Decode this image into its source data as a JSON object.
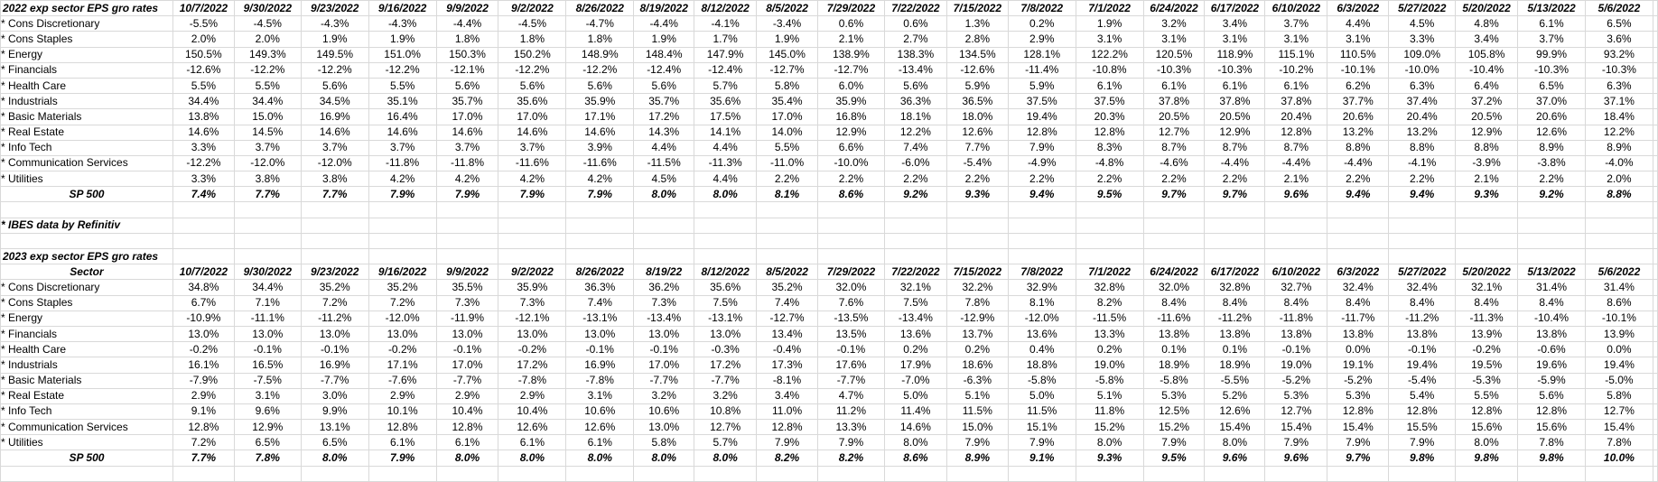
{
  "table_2022": {
    "title": "2022 exp sector EPS gro rates",
    "dates": [
      "10/7/2022",
      "9/30/2022",
      "9/23/2022",
      "9/16/2022",
      "9/9/2022",
      "9/2/2022",
      "8/26/2022",
      "8/19/2022",
      "8/12/2022",
      "8/5/2022",
      "7/29/2022",
      "7/22/2022",
      "7/15/2022",
      "7/8/2022",
      "7/1/2022",
      "6/24/2022",
      "6/17/2022",
      "6/10/2022",
      "6/3/2022",
      "5/27/2022",
      "5/20/2022",
      "5/13/2022",
      "5/6/2022"
    ],
    "rows": [
      {
        "label": "* Cons Discretionary",
        "values": [
          "-5.5%",
          "-4.5%",
          "-4.3%",
          "-4.3%",
          "-4.4%",
          "-4.5%",
          "-4.7%",
          "-4.4%",
          "-4.1%",
          "-3.4%",
          "0.6%",
          "0.6%",
          "1.3%",
          "0.2%",
          "1.9%",
          "3.2%",
          "3.4%",
          "3.7%",
          "4.4%",
          "4.5%",
          "4.8%",
          "6.1%",
          "6.5%"
        ]
      },
      {
        "label": "* Cons Staples",
        "values": [
          "2.0%",
          "2.0%",
          "1.9%",
          "1.9%",
          "1.8%",
          "1.8%",
          "1.8%",
          "1.9%",
          "1.7%",
          "1.9%",
          "2.1%",
          "2.7%",
          "2.8%",
          "2.9%",
          "3.1%",
          "3.1%",
          "3.1%",
          "3.1%",
          "3.1%",
          "3.3%",
          "3.4%",
          "3.7%",
          "3.6%"
        ]
      },
      {
        "label": "* Energy",
        "values": [
          "150.5%",
          "149.3%",
          "149.5%",
          "151.0%",
          "150.3%",
          "150.2%",
          "148.9%",
          "148.4%",
          "147.9%",
          "145.0%",
          "138.9%",
          "138.3%",
          "134.5%",
          "128.1%",
          "122.2%",
          "120.5%",
          "118.9%",
          "115.1%",
          "110.5%",
          "109.0%",
          "105.8%",
          "99.9%",
          "93.2%"
        ]
      },
      {
        "label": "* Financials",
        "values": [
          "-12.6%",
          "-12.2%",
          "-12.2%",
          "-12.2%",
          "-12.1%",
          "-12.2%",
          "-12.2%",
          "-12.4%",
          "-12.4%",
          "-12.7%",
          "-12.7%",
          "-13.4%",
          "-12.6%",
          "-11.4%",
          "-10.8%",
          "-10.3%",
          "-10.3%",
          "-10.2%",
          "-10.1%",
          "-10.0%",
          "-10.4%",
          "-10.3%",
          "-10.3%"
        ]
      },
      {
        "label": "* Health Care",
        "values": [
          "5.5%",
          "5.5%",
          "5.6%",
          "5.5%",
          "5.6%",
          "5.6%",
          "5.6%",
          "5.6%",
          "5.7%",
          "5.8%",
          "6.0%",
          "5.6%",
          "5.9%",
          "5.9%",
          "6.1%",
          "6.1%",
          "6.1%",
          "6.1%",
          "6.2%",
          "6.3%",
          "6.4%",
          "6.5%",
          "6.3%"
        ]
      },
      {
        "label": "* Industrials",
        "values": [
          "34.4%",
          "34.4%",
          "34.5%",
          "35.1%",
          "35.7%",
          "35.6%",
          "35.9%",
          "35.7%",
          "35.6%",
          "35.4%",
          "35.9%",
          "36.3%",
          "36.5%",
          "37.5%",
          "37.5%",
          "37.8%",
          "37.8%",
          "37.8%",
          "37.7%",
          "37.4%",
          "37.2%",
          "37.0%",
          "37.1%"
        ]
      },
      {
        "label": "* Basic Materials",
        "values": [
          "13.8%",
          "15.0%",
          "16.9%",
          "16.4%",
          "17.0%",
          "17.0%",
          "17.1%",
          "17.2%",
          "17.5%",
          "17.0%",
          "16.8%",
          "18.1%",
          "18.0%",
          "19.4%",
          "20.3%",
          "20.5%",
          "20.5%",
          "20.4%",
          "20.6%",
          "20.4%",
          "20.5%",
          "20.6%",
          "18.4%"
        ]
      },
      {
        "label": "* Real Estate",
        "values": [
          "14.6%",
          "14.5%",
          "14.6%",
          "14.6%",
          "14.6%",
          "14.6%",
          "14.6%",
          "14.3%",
          "14.1%",
          "14.0%",
          "12.9%",
          "12.2%",
          "12.6%",
          "12.8%",
          "12.8%",
          "12.7%",
          "12.9%",
          "12.8%",
          "13.2%",
          "13.2%",
          "12.9%",
          "12.6%",
          "12.2%"
        ]
      },
      {
        "label": "* Info Tech",
        "values": [
          "3.3%",
          "3.7%",
          "3.7%",
          "3.7%",
          "3.7%",
          "3.7%",
          "3.9%",
          "4.4%",
          "4.4%",
          "5.5%",
          "6.6%",
          "7.4%",
          "7.7%",
          "7.9%",
          "8.3%",
          "8.7%",
          "8.7%",
          "8.7%",
          "8.8%",
          "8.8%",
          "8.8%",
          "8.9%",
          "8.9%"
        ]
      },
      {
        "label": "* Communication Services",
        "values": [
          "-12.2%",
          "-12.0%",
          "-12.0%",
          "-11.8%",
          "-11.8%",
          "-11.6%",
          "-11.6%",
          "-11.5%",
          "-11.3%",
          "-11.0%",
          "-10.0%",
          "-6.0%",
          "-5.4%",
          "-4.9%",
          "-4.8%",
          "-4.6%",
          "-4.4%",
          "-4.4%",
          "-4.4%",
          "-4.1%",
          "-3.9%",
          "-3.8%",
          "-4.0%"
        ]
      },
      {
        "label": "* Utilities",
        "values": [
          "3.3%",
          "3.8%",
          "3.8%",
          "4.2%",
          "4.2%",
          "4.2%",
          "4.2%",
          "4.5%",
          "4.4%",
          "2.2%",
          "2.2%",
          "2.2%",
          "2.2%",
          "2.2%",
          "2.2%",
          "2.2%",
          "2.2%",
          "2.1%",
          "2.2%",
          "2.2%",
          "2.1%",
          "2.2%",
          "2.0%"
        ]
      }
    ],
    "total": {
      "label": "SP 500",
      "values": [
        "7.4%",
        "7.7%",
        "7.7%",
        "7.9%",
        "7.9%",
        "7.9%",
        "7.9%",
        "8.0%",
        "8.0%",
        "8.1%",
        "8.6%",
        "9.2%",
        "9.3%",
        "9.4%",
        "9.5%",
        "9.7%",
        "9.7%",
        "9.6%",
        "9.4%",
        "9.4%",
        "9.3%",
        "9.2%",
        "8.8%"
      ]
    }
  },
  "note": "* IBES data by Refinitiv",
  "table_2023": {
    "title": "2023 exp sector EPS gro rates",
    "header_label": "Sector",
    "dates": [
      "10/7/2022",
      "9/30/2022",
      "9/23/2022",
      "9/16/2022",
      "9/9/2022",
      "9/2/2022",
      "8/26/2022",
      "8/19/22",
      "8/12/2022",
      "8/5/2022",
      "7/29/2022",
      "7/22/2022",
      "7/15/2022",
      "7/8/2022",
      "7/1/2022",
      "6/24/2022",
      "6/17/2022",
      "6/10/2022",
      "6/3/2022",
      "5/27/2022",
      "5/20/2022",
      "5/13/2022",
      "5/6/2022"
    ],
    "rows": [
      {
        "label": "* Cons Discretionary",
        "values": [
          "34.8%",
          "34.4%",
          "35.2%",
          "35.2%",
          "35.5%",
          "35.9%",
          "36.3%",
          "36.2%",
          "35.6%",
          "35.2%",
          "32.0%",
          "32.1%",
          "32.2%",
          "32.9%",
          "32.8%",
          "32.0%",
          "32.8%",
          "32.7%",
          "32.4%",
          "32.4%",
          "32.1%",
          "31.4%",
          "31.4%"
        ]
      },
      {
        "label": "* Cons Staples",
        "values": [
          "6.7%",
          "7.1%",
          "7.2%",
          "7.2%",
          "7.3%",
          "7.3%",
          "7.4%",
          "7.3%",
          "7.5%",
          "7.4%",
          "7.6%",
          "7.5%",
          "7.8%",
          "8.1%",
          "8.2%",
          "8.4%",
          "8.4%",
          "8.4%",
          "8.4%",
          "8.4%",
          "8.4%",
          "8.4%",
          "8.6%"
        ]
      },
      {
        "label": "* Energy",
        "values": [
          "-10.9%",
          "-11.1%",
          "-11.2%",
          "-12.0%",
          "-11.9%",
          "-12.1%",
          "-13.1%",
          "-13.4%",
          "-13.1%",
          "-12.7%",
          "-13.5%",
          "-13.4%",
          "-12.9%",
          "-12.0%",
          "-11.5%",
          "-11.6%",
          "-11.2%",
          "-11.8%",
          "-11.7%",
          "-11.2%",
          "-11.3%",
          "-10.4%",
          "-10.1%"
        ]
      },
      {
        "label": "* Financials",
        "values": [
          "13.0%",
          "13.0%",
          "13.0%",
          "13.0%",
          "13.0%",
          "13.0%",
          "13.0%",
          "13.0%",
          "13.0%",
          "13.4%",
          "13.5%",
          "13.6%",
          "13.7%",
          "13.6%",
          "13.3%",
          "13.8%",
          "13.8%",
          "13.8%",
          "13.8%",
          "13.8%",
          "13.9%",
          "13.8%",
          "13.9%"
        ]
      },
      {
        "label": "* Health Care",
        "values": [
          "-0.2%",
          "-0.1%",
          "-0.1%",
          "-0.2%",
          "-0.1%",
          "-0.2%",
          "-0.1%",
          "-0.1%",
          "-0.3%",
          "-0.4%",
          "-0.1%",
          "0.2%",
          "0.2%",
          "0.4%",
          "0.2%",
          "0.1%",
          "0.1%",
          "-0.1%",
          "0.0%",
          "-0.1%",
          "-0.2%",
          "-0.6%",
          "0.0%"
        ]
      },
      {
        "label": "* Industrials",
        "values": [
          "16.1%",
          "16.5%",
          "16.9%",
          "17.1%",
          "17.0%",
          "17.2%",
          "16.9%",
          "17.0%",
          "17.2%",
          "17.3%",
          "17.6%",
          "17.9%",
          "18.6%",
          "18.8%",
          "19.0%",
          "18.9%",
          "18.9%",
          "19.0%",
          "19.1%",
          "19.4%",
          "19.5%",
          "19.6%",
          "19.4%"
        ]
      },
      {
        "label": "* Basic Materials",
        "values": [
          "-7.9%",
          "-7.5%",
          "-7.7%",
          "-7.6%",
          "-7.7%",
          "-7.8%",
          "-7.8%",
          "-7.7%",
          "-7.7%",
          "-8.1%",
          "-7.7%",
          "-7.0%",
          "-6.3%",
          "-5.8%",
          "-5.8%",
          "-5.8%",
          "-5.5%",
          "-5.2%",
          "-5.2%",
          "-5.4%",
          "-5.3%",
          "-5.9%",
          "-5.0%"
        ]
      },
      {
        "label": "* Real Estate",
        "values": [
          "2.9%",
          "3.1%",
          "3.0%",
          "2.9%",
          "2.9%",
          "2.9%",
          "3.1%",
          "3.2%",
          "3.2%",
          "3.4%",
          "4.7%",
          "5.0%",
          "5.1%",
          "5.0%",
          "5.1%",
          "5.3%",
          "5.2%",
          "5.3%",
          "5.3%",
          "5.4%",
          "5.5%",
          "5.6%",
          "5.8%"
        ]
      },
      {
        "label": "* Info Tech",
        "values": [
          "9.1%",
          "9.6%",
          "9.9%",
          "10.1%",
          "10.4%",
          "10.4%",
          "10.6%",
          "10.6%",
          "10.8%",
          "11.0%",
          "11.2%",
          "11.4%",
          "11.5%",
          "11.5%",
          "11.8%",
          "12.5%",
          "12.6%",
          "12.7%",
          "12.8%",
          "12.8%",
          "12.8%",
          "12.8%",
          "12.7%"
        ]
      },
      {
        "label": "* Communication Services",
        "values": [
          "12.8%",
          "12.9%",
          "13.1%",
          "12.8%",
          "12.8%",
          "12.6%",
          "12.6%",
          "13.0%",
          "12.7%",
          "12.8%",
          "13.3%",
          "14.6%",
          "15.0%",
          "15.1%",
          "15.2%",
          "15.2%",
          "15.4%",
          "15.4%",
          "15.4%",
          "15.5%",
          "15.6%",
          "15.6%",
          "15.4%"
        ]
      },
      {
        "label": "* Utilities",
        "values": [
          "7.2%",
          "6.5%",
          "6.5%",
          "6.1%",
          "6.1%",
          "6.1%",
          "6.1%",
          "5.8%",
          "5.7%",
          "7.9%",
          "7.9%",
          "8.0%",
          "7.9%",
          "7.9%",
          "8.0%",
          "7.9%",
          "8.0%",
          "7.9%",
          "7.9%",
          "7.9%",
          "8.0%",
          "7.8%",
          "7.8%"
        ]
      }
    ],
    "total": {
      "label": "SP 500",
      "values": [
        "7.7%",
        "7.8%",
        "8.0%",
        "7.9%",
        "8.0%",
        "8.0%",
        "8.0%",
        "8.0%",
        "8.0%",
        "8.2%",
        "8.2%",
        "8.6%",
        "8.9%",
        "9.1%",
        "9.3%",
        "9.5%",
        "9.6%",
        "9.6%",
        "9.7%",
        "9.8%",
        "9.8%",
        "9.8%",
        "10.0%"
      ]
    }
  }
}
